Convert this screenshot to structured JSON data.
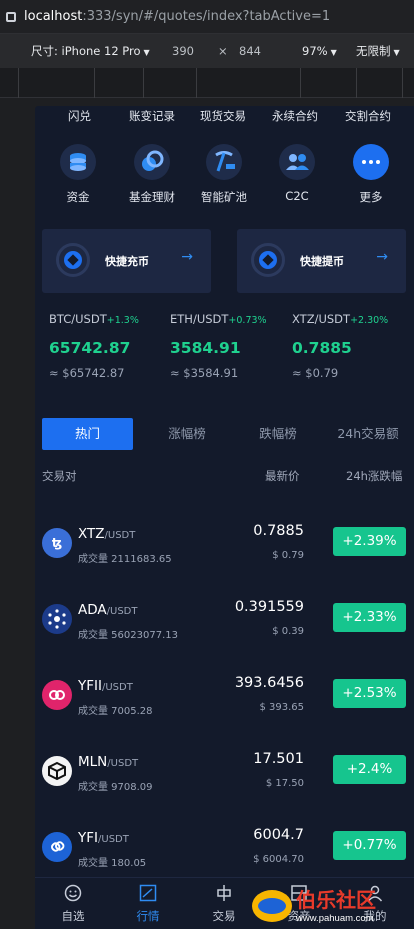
{
  "browser": {
    "url_host": "localhost",
    "url_path": ":333/syn/#/quotes/index?tabActive=1",
    "device_label": "尺寸: iPhone 12 Pro",
    "width_value": "390",
    "times_sign": "×",
    "height_value": "844",
    "zoom": "97%",
    "throttle": "无限制"
  },
  "top_menu": [
    "闪兑",
    "账变记录",
    "现货交易",
    "永续合约",
    "交割合约"
  ],
  "shortcuts": [
    {
      "label": "资金",
      "icon": "wallet-icon"
    },
    {
      "label": "基金理财",
      "icon": "coins-icon"
    },
    {
      "label": "智能矿池",
      "icon": "pickaxe-icon"
    },
    {
      "label": "C2C",
      "icon": "users-icon"
    },
    {
      "label": "更多",
      "icon": "more-icon"
    }
  ],
  "quick_actions": {
    "deposit": "快捷充币",
    "withdraw": "快捷提币"
  },
  "tickers": [
    {
      "pair": "BTC/USDT",
      "change": "+1.3%",
      "price": "65742.87",
      "fiat": "≈ $65742.87"
    },
    {
      "pair": "ETH/USDT",
      "change": "+0.73%",
      "price": "3584.91",
      "fiat": "≈ $3584.91"
    },
    {
      "pair": "XTZ/USDT",
      "change": "+2.30%",
      "price": "0.7885",
      "fiat": "≈ $0.79"
    }
  ],
  "tabs": [
    "热门",
    "涨幅榜",
    "跌幅榜",
    "24h交易额"
  ],
  "active_tab": "热门",
  "table": {
    "col_pair": "交易对",
    "col_last": "最新价",
    "col_change": "24h涨跌幅",
    "rows": [
      {
        "base": "XTZ",
        "quote": "/USDT",
        "volume": "成交量 2111683.65",
        "last": "0.7885",
        "fiat": "$ 0.79",
        "change": "+2.39%",
        "icon": "tezos-icon",
        "color": "#3a6fd8"
      },
      {
        "base": "ADA",
        "quote": "/USDT",
        "volume": "成交量 56023077.13",
        "last": "0.391559",
        "fiat": "$ 0.39",
        "change": "+2.33%",
        "icon": "cardano-icon",
        "color": "#1c3b8a"
      },
      {
        "base": "YFII",
        "quote": "/USDT",
        "volume": "成交量 7005.28",
        "last": "393.6456",
        "fiat": "$ 393.65",
        "change": "+2.53%",
        "icon": "yfii-icon",
        "color": "#e0246b"
      },
      {
        "base": "MLN",
        "quote": "/USDT",
        "volume": "成交量 9708.09",
        "last": "17.501",
        "fiat": "$ 17.50",
        "change": "+2.4%",
        "icon": "melon-icon",
        "color": "#f4f4f4"
      },
      {
        "base": "YFI",
        "quote": "/USDT",
        "volume": "成交量 180.05",
        "last": "6004.7",
        "fiat": "$ 6004.70",
        "change": "+0.77%",
        "icon": "yfi-icon",
        "color": "#1d63d6"
      }
    ]
  },
  "bottom_nav": [
    {
      "label": "自选",
      "icon": "smile-icon"
    },
    {
      "label": "行情",
      "icon": "chart-icon"
    },
    {
      "label": "交易",
      "icon": "trade-icon"
    },
    {
      "label": "资产",
      "icon": "asset-icon"
    },
    {
      "label": "我的",
      "icon": "profile-icon"
    }
  ],
  "active_nav": "行情",
  "watermark": {
    "title": "伯乐社区",
    "url": "www.pahuam.com"
  },
  "colors": {
    "accent": "#1d6ff0",
    "up": "#16c58e",
    "background": "#131a2b"
  }
}
